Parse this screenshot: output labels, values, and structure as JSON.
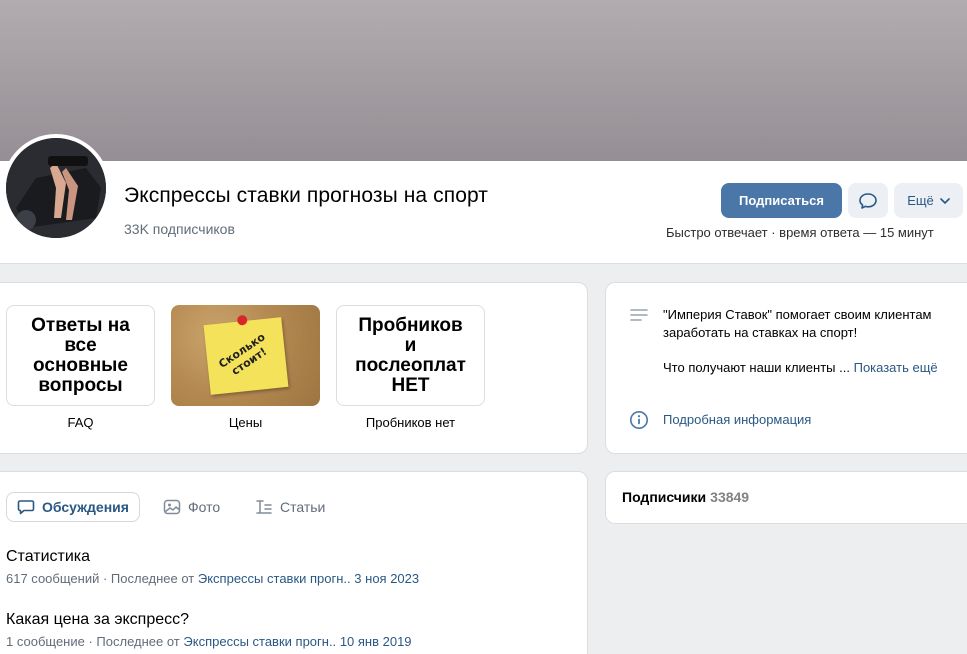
{
  "group": {
    "title": "Экспрессы ставки прогнозы на спорт",
    "subscribers": "33K подписчиков"
  },
  "actions": {
    "subscribe": "Подписаться",
    "more": "Ещё",
    "reply_time": "Быстро отвечает · время ответа — 15 минут"
  },
  "links": [
    {
      "tile_text_lines": [
        "Ответы на",
        "все",
        "основные",
        "вопросы"
      ],
      "caption": "FAQ"
    },
    {
      "tile_text_lines": [
        "Сколько",
        "стоит!"
      ],
      "caption": "Цены"
    },
    {
      "tile_text_lines": [
        "Пробников",
        "и",
        "послеоплат",
        "НЕТ"
      ],
      "caption": "Пробников нет"
    }
  ],
  "about": {
    "line1": "\"Империя Ставок\" помогает своим клиентам заработать на ставках на спорт!",
    "line2": "Что получают наши клиенты ...",
    "show_more": "Показать ещё",
    "details": "Подробная информация"
  },
  "tabs": {
    "discussions": "Обсуждения",
    "photos": "Фото",
    "articles": "Статьи"
  },
  "topics": [
    {
      "title": "Статистика",
      "count": "617 сообщений",
      "last_from": "Последнее от",
      "author": "Экспрессы ставки прогн..",
      "date": "3 ноя 2023"
    },
    {
      "title": "Какая цена за экспресс?",
      "count": "1 сообщение",
      "last_from": "Последнее от",
      "author": "Экспрессы ставки прогн..",
      "date": "10 янв 2019"
    }
  ],
  "members": {
    "label": "Подписчики",
    "count": "33849"
  },
  "colors": {
    "accent": "#4a76a8",
    "link": "#2a5885",
    "background": "#edeef0"
  }
}
